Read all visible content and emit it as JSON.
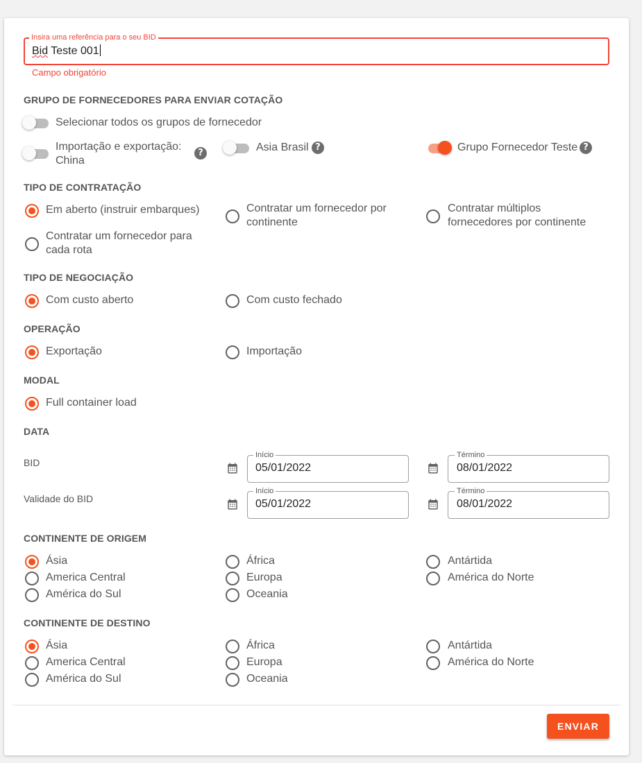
{
  "reference": {
    "label": "Insira uma referência para o seu BID",
    "value_prefix": "Bid",
    "value_rest": " Teste 001",
    "error": "Campo obrigatório"
  },
  "supplier_groups": {
    "title": "GRUPO DE FORNECEDORES PARA ENVIAR COTAÇÃO",
    "select_all": {
      "label": "Selecionar todos os grupos de fornecedor",
      "checked": false
    },
    "groups": [
      {
        "line1": "Importação e exportação:",
        "line2": "China",
        "checked": false
      },
      {
        "line1": "Asia Brasil",
        "checked": false
      },
      {
        "line1": "Grupo Fornecedor Teste",
        "checked": true
      }
    ],
    "help_glyph": "?"
  },
  "contract_type": {
    "title": "TIPO DE CONTRATAÇÃO",
    "options": [
      {
        "line1": "Em aberto (instruir embarques)",
        "checked": true
      },
      {
        "line1": "Contratar um fornecedor por",
        "line2": "continente",
        "checked": false
      },
      {
        "line1": "Contratar múltiplos",
        "line2": "fornecedores por continente",
        "checked": false
      },
      {
        "line1": "Contratar um fornecedor para",
        "line2": "cada rota",
        "checked": false
      }
    ]
  },
  "negotiation_type": {
    "title": "TIPO DE NEGOCIAÇÃO",
    "options": [
      {
        "label": "Com custo aberto",
        "checked": true
      },
      {
        "label": "Com custo fechado",
        "checked": false
      }
    ]
  },
  "operation": {
    "title": "OPERAÇÃO",
    "options": [
      {
        "label": "Exportação",
        "checked": true
      },
      {
        "label": "Importação",
        "checked": false
      }
    ]
  },
  "modal": {
    "title": "MODAL",
    "options": [
      {
        "label": "Full container load",
        "checked": true
      }
    ]
  },
  "date": {
    "title": "DATA",
    "rows": [
      {
        "label": "BID",
        "start_label": "Início",
        "start": "05/01/2022",
        "end_label": "Término",
        "end": "08/01/2022"
      },
      {
        "label": "Validade do BID",
        "start_label": "Início",
        "start": "05/01/2022",
        "end_label": "Término",
        "end": "08/01/2022"
      }
    ]
  },
  "origin": {
    "title": "CONTINENTE DE ORIGEM",
    "options": [
      {
        "label": "Ásia",
        "checked": true
      },
      {
        "label": "África",
        "checked": false
      },
      {
        "label": "Antártida",
        "checked": false
      },
      {
        "label": "America Central",
        "checked": false
      },
      {
        "label": "Europa",
        "checked": false
      },
      {
        "label": "América do Norte",
        "checked": false
      },
      {
        "label": "América do Sul",
        "checked": false
      },
      {
        "label": "Oceania",
        "checked": false
      }
    ]
  },
  "destination": {
    "title": "CONTINENTE DE DESTINO",
    "options": [
      {
        "label": "Ásia",
        "checked": true
      },
      {
        "label": "África",
        "checked": false
      },
      {
        "label": "Antártida",
        "checked": false
      },
      {
        "label": "America Central",
        "checked": false
      },
      {
        "label": "Europa",
        "checked": false
      },
      {
        "label": "América do Norte",
        "checked": false
      },
      {
        "label": "América do Sul",
        "checked": false
      },
      {
        "label": "Oceania",
        "checked": false
      }
    ]
  },
  "submit": {
    "label": "ENVIAR"
  },
  "colors": {
    "accent": "#f4511e",
    "error": "#f44336",
    "switch_track_on": "#f7a086"
  },
  "icons": {
    "help": "help-circle-icon",
    "calendar": "calendar-icon"
  }
}
